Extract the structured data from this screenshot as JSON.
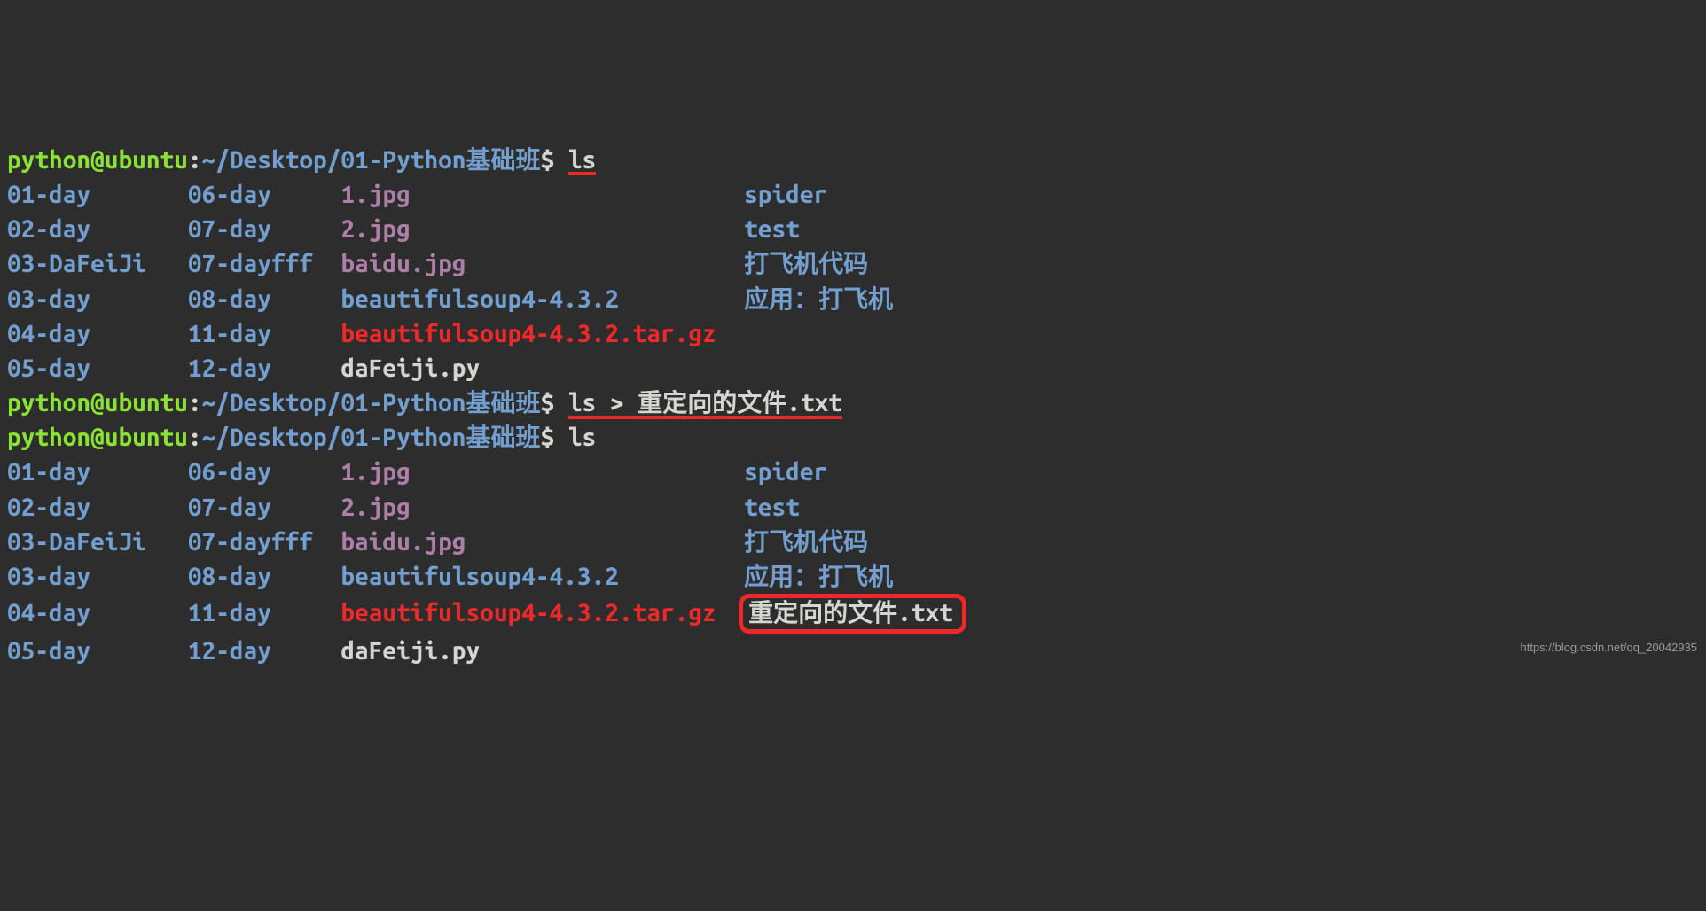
{
  "prompt": {
    "user": "python",
    "at": "@",
    "host": "ubuntu",
    "colon": ":",
    "path": "~/Desktop/01-Python基础班",
    "dollar": "$ "
  },
  "commands": {
    "ls1": "ls",
    "redirect": "ls > 重定向的文件.txt",
    "ls2": "ls"
  },
  "listing1": {
    "col1": [
      "01-day",
      "02-day",
      "03-DaFeiJi",
      "03-day",
      "04-day",
      "05-day"
    ],
    "col2": [
      "06-day",
      "07-day",
      "07-dayfff",
      "08-day",
      "11-day",
      "12-day"
    ],
    "col3": [
      "1.jpg",
      "2.jpg",
      "baidu.jpg",
      "beautifulsoup4-4.3.2",
      "beautifulsoup4-4.3.2.tar.gz",
      "daFeiji.py"
    ],
    "col4": [
      "spider",
      "test",
      "打飞机代码",
      "应用：打飞机"
    ]
  },
  "listing2": {
    "col1": [
      "01-day",
      "02-day",
      "03-DaFeiJi",
      "03-day",
      "04-day",
      "05-day"
    ],
    "col2": [
      "06-day",
      "07-day",
      "07-dayfff",
      "08-day",
      "11-day",
      "12-day"
    ],
    "col3": [
      "1.jpg",
      "2.jpg",
      "baidu.jpg",
      "beautifulsoup4-4.3.2",
      "beautifulsoup4-4.3.2.tar.gz",
      "daFeiji.py"
    ],
    "col4": [
      "spider",
      "test",
      "打飞机代码",
      "应用：打飞机",
      "重定向的文件.txt"
    ]
  },
  "watermark": "https://blog.csdn.net/qq_20042935"
}
